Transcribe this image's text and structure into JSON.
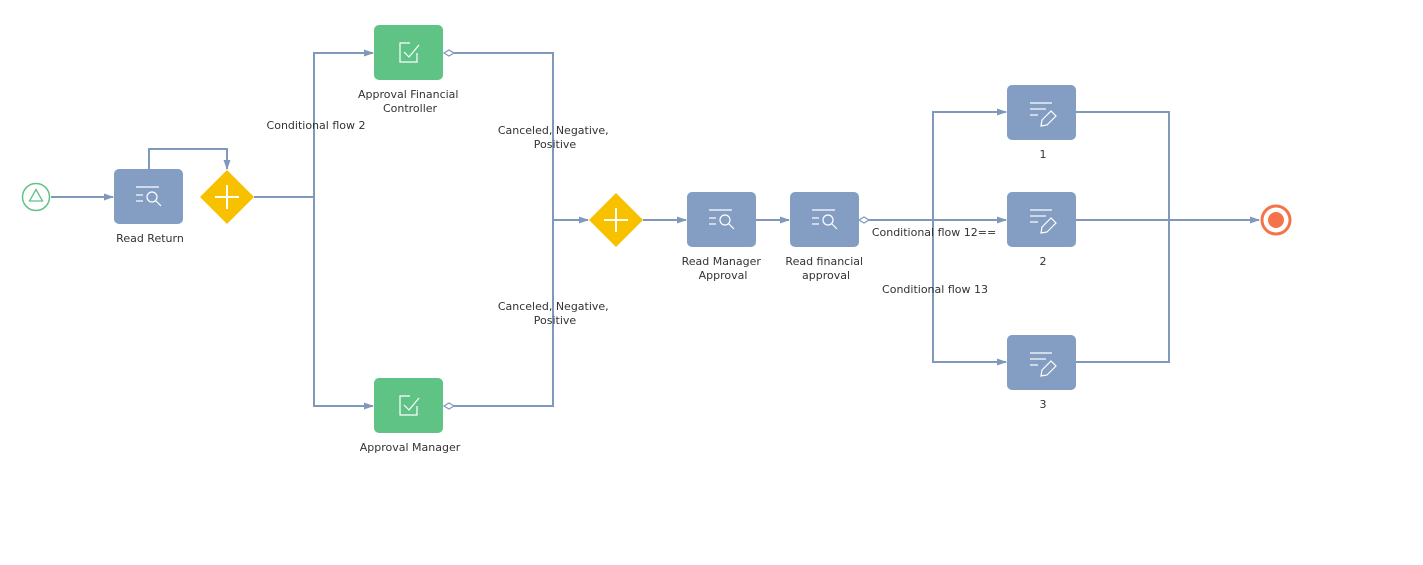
{
  "diagram": {
    "colors": {
      "line": "#8098bb",
      "read_task": "#839ec2",
      "approval_task": "#5ec384",
      "gateway": "#f8c100",
      "start_event": "#5ec384",
      "end_event": "#f6734a",
      "label": "#333333"
    },
    "nodes": [
      {
        "id": "start",
        "type": "start-event",
        "label": ""
      },
      {
        "id": "read_return",
        "type": "read-task",
        "icon": "read-data-icon",
        "label": [
          "Read Return"
        ]
      },
      {
        "id": "gw1",
        "type": "parallel-gateway",
        "label": ""
      },
      {
        "id": "approval_fc",
        "type": "approval-task",
        "icon": "approval-check-icon",
        "label": [
          "Approval Financial",
          "Controller"
        ]
      },
      {
        "id": "approval_mgr",
        "type": "approval-task",
        "icon": "approval-check-icon",
        "label": [
          "Approval Manager"
        ]
      },
      {
        "id": "gw2",
        "type": "parallel-gateway",
        "label": ""
      },
      {
        "id": "read_mgr",
        "type": "read-task",
        "icon": "read-data-icon",
        "label": [
          "Read Manager",
          "Approval"
        ]
      },
      {
        "id": "read_fin",
        "type": "read-task",
        "icon": "read-data-icon",
        "label": [
          "Read financial",
          "approval"
        ]
      },
      {
        "id": "edit1",
        "type": "edit-task",
        "icon": "edit-data-icon",
        "label": [
          "1"
        ]
      },
      {
        "id": "edit2",
        "type": "edit-task",
        "icon": "edit-data-icon",
        "label": [
          "2"
        ]
      },
      {
        "id": "edit3",
        "type": "edit-task",
        "icon": "edit-data-icon",
        "label": [
          "3"
        ]
      },
      {
        "id": "end",
        "type": "end-event",
        "label": ""
      }
    ],
    "flow_labels": [
      {
        "id": "cf2",
        "lines": [
          "Conditional flow 2"
        ]
      },
      {
        "id": "cnp_top",
        "lines": [
          "Canceled, Negative,",
          "Positive"
        ]
      },
      {
        "id": "cnp_bottom",
        "lines": [
          "Canceled, Negative,",
          "Positive"
        ]
      },
      {
        "id": "cf12",
        "lines": [
          "Conditional flow 12=="
        ]
      },
      {
        "id": "cf13",
        "lines": [
          "Conditional flow 13"
        ]
      }
    ]
  }
}
